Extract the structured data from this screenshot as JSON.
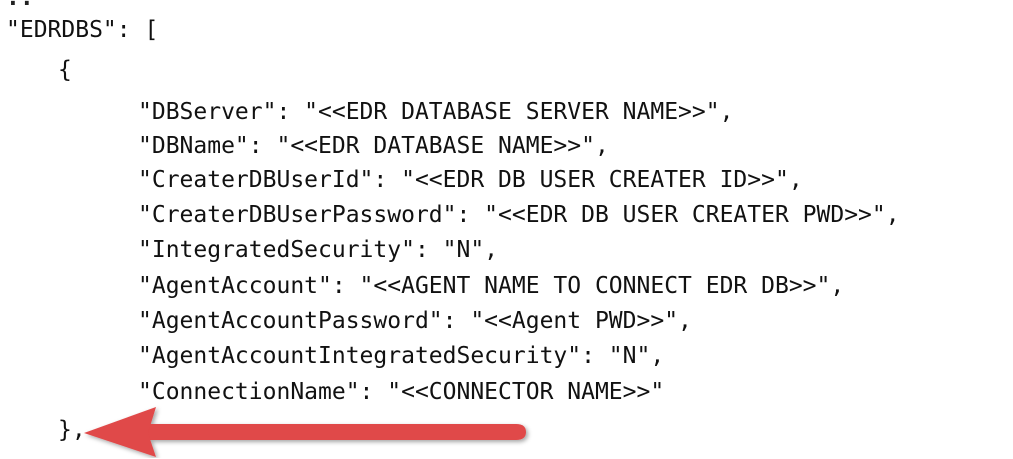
{
  "code": {
    "top_fragment": "..",
    "lines": [
      "\"EDRDBS\": [",
      "{",
      "\"DBServer\": \"<<EDR DATABASE SERVER NAME>>\",",
      "\"DBName\": \"<<EDR DATABASE NAME>>\",",
      "\"CreaterDBUserId\": \"<<EDR DB USER CREATER ID>>\",",
      "\"CreaterDBUserPassword\": \"<<EDR DB USER CREATER PWD>>\",",
      "\"IntegratedSecurity\": \"N\",",
      "\"AgentAccount\": \"<<AGENT NAME TO CONNECT EDR DB>>\",",
      "\"AgentAccountPassword\": \"<<Agent PWD>>\",",
      "\"AgentAccountIntegratedSecurity\": \"N\",",
      "\"ConnectionName\": \"<<CONNECTOR NAME>>\"",
      "},"
    ]
  },
  "annotation": {
    "arrow_color": "#e04848",
    "arrow_icon": "left-arrow-icon"
  }
}
